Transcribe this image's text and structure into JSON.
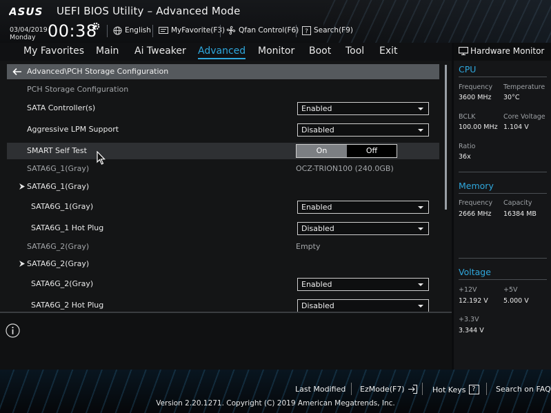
{
  "window": {
    "logo_text": "ASUS",
    "title": "UEFI BIOS Utility – Advanced Mode"
  },
  "topbar": {
    "date": "03/04/2019",
    "day": "Monday",
    "time": "00:38",
    "language": "English",
    "myfavorite": "MyFavorite(F3)",
    "qfan": "Qfan Control(F6)",
    "search": "Search(F9)"
  },
  "menu": {
    "items": [
      "My Favorites",
      "Main",
      "Ai Tweaker",
      "Advanced",
      "Monitor",
      "Boot",
      "Tool",
      "Exit"
    ],
    "active": "Advanced"
  },
  "main": {
    "breadcrumb": "Advanced\\PCH Storage Configuration",
    "section_title": "PCH Storage Configuration",
    "rows": [
      {
        "label": "SATA Controller(s)",
        "value": "Enabled"
      },
      {
        "label": "Aggressive LPM Support",
        "value": "Disabled"
      },
      {
        "label": "SMART Self Test",
        "toggle_on": "On",
        "toggle_off": "Off",
        "selected": "On"
      },
      {
        "label": "SATA6G_1(Gray)",
        "info": "OCZ-TRION100 (240.0GB)"
      },
      {
        "label": "SATA6G_1(Gray)"
      },
      {
        "label": "SATA6G_1(Gray)",
        "value": "Enabled"
      },
      {
        "label": "SATA6G_1 Hot Plug",
        "value": "Disabled"
      },
      {
        "label": "SATA6G_2(Gray)",
        "info": "Empty"
      },
      {
        "label": "SATA6G_2(Gray)"
      },
      {
        "label": "SATA6G_2(Gray)",
        "value": "Enabled"
      },
      {
        "label": "SATA6G_2 Hot Plug",
        "value": "Disabled"
      }
    ]
  },
  "hw_monitor": {
    "title": "Hardware Monitor",
    "cpu": {
      "title": "CPU",
      "frequency_label": "Frequency",
      "frequency": "3600 MHz",
      "temperature_label": "Temperature",
      "temperature": "30°C",
      "bclk_label": "BCLK",
      "bclk": "100.00 MHz",
      "core_voltage_label": "Core Voltage",
      "core_voltage": "1.104 V",
      "ratio_label": "Ratio",
      "ratio": "36x"
    },
    "memory": {
      "title": "Memory",
      "frequency_label": "Frequency",
      "frequency": "2666 MHz",
      "capacity_label": "Capacity",
      "capacity": "16384 MB"
    },
    "voltage": {
      "title": "Voltage",
      "v12_label": "+12V",
      "v12": "12.192 V",
      "v5_label": "+5V",
      "v5": "5.000 V",
      "v33_label": "+3.3V",
      "v33": "3.344 V"
    }
  },
  "footer": {
    "last_modified": "Last Modified",
    "ezmode": "EzMode(F7)",
    "hotkeys": "Hot Keys",
    "hotkeys_key": "?",
    "search_faq": "Search on FAQ",
    "copyright": "Version 2.20.1271. Copyright (C) 2019 American Megatrends, Inc."
  },
  "colors": {
    "accent": "#2fa8de",
    "highlight_row": "#2e3033",
    "breadcrumb_bar": "#55595d"
  }
}
